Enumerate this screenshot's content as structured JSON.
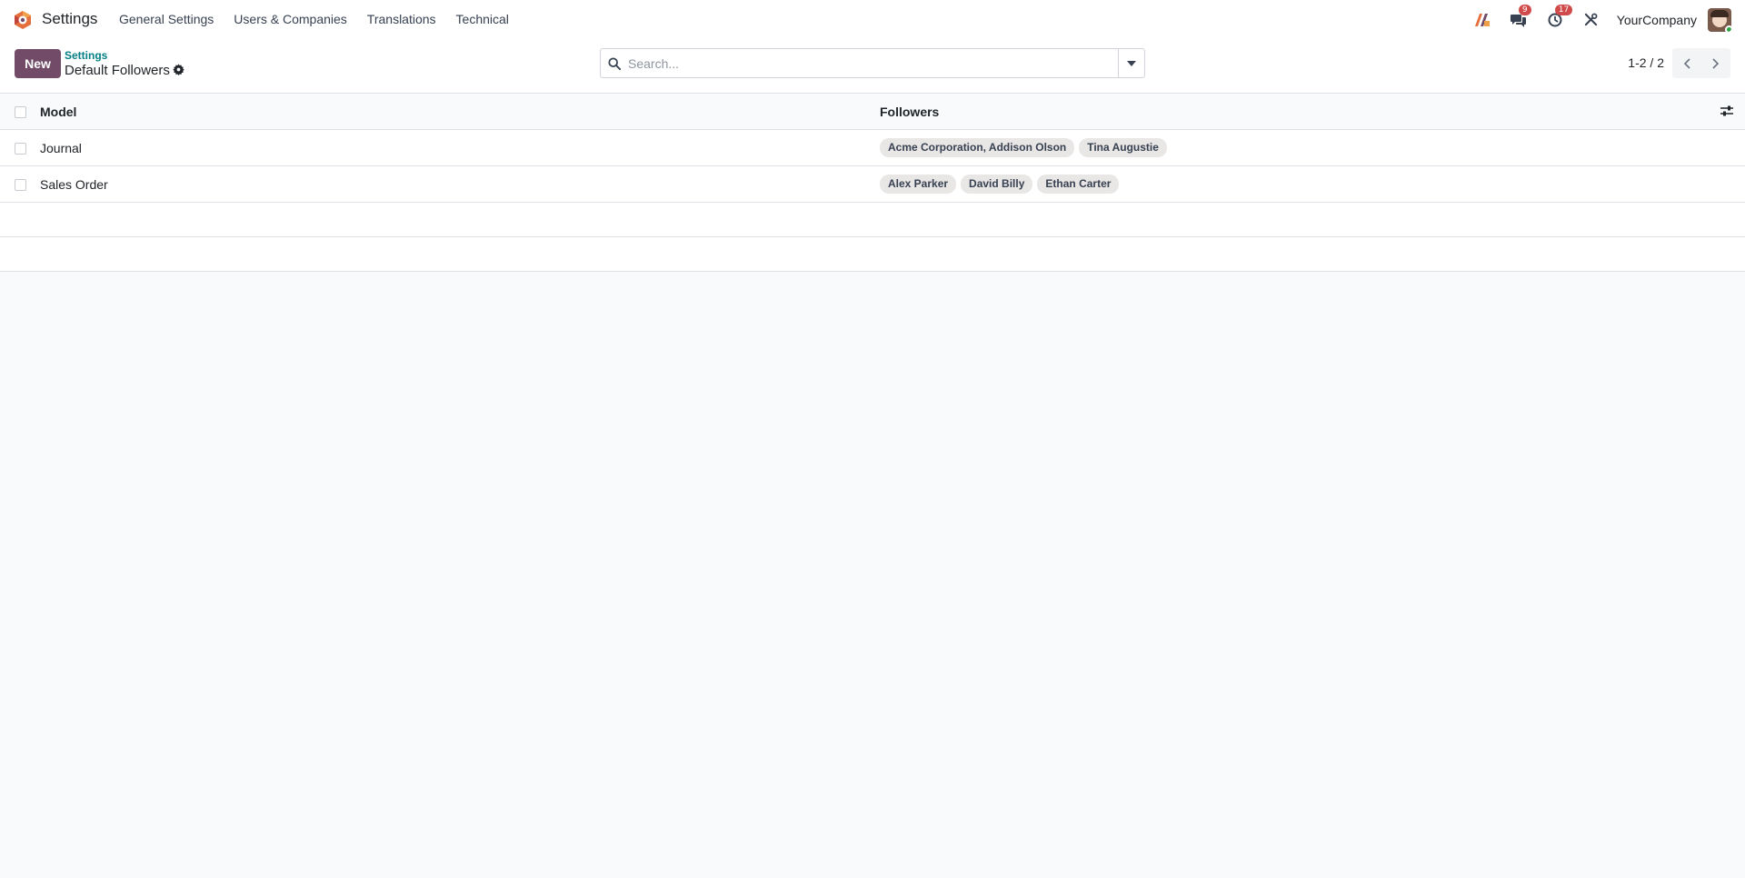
{
  "navbar": {
    "app_name": "Settings",
    "menu": [
      {
        "label": "General Settings"
      },
      {
        "label": "Users & Companies"
      },
      {
        "label": "Translations"
      },
      {
        "label": "Technical"
      }
    ],
    "messages_badge": "9",
    "activities_badge": "17",
    "company": "YourCompany"
  },
  "control_panel": {
    "new_label": "New",
    "breadcrumb_parent": "Settings",
    "title": "Default Followers",
    "search_placeholder": "Search...",
    "pager": "1-2 / 2"
  },
  "table": {
    "columns": {
      "model": "Model",
      "followers": "Followers"
    },
    "rows": [
      {
        "model": "Journal",
        "followers": [
          "Acme Corporation, Addison Olson",
          "Tina Augustie"
        ]
      },
      {
        "model": "Sales Order",
        "followers": [
          "Alex Parker",
          "David Billy",
          "Ethan Carter"
        ]
      }
    ]
  },
  "colors": {
    "brand": "#714b67",
    "link": "#017e84",
    "badge": "#d04a4a",
    "tag_bg": "#e9e6e6"
  }
}
